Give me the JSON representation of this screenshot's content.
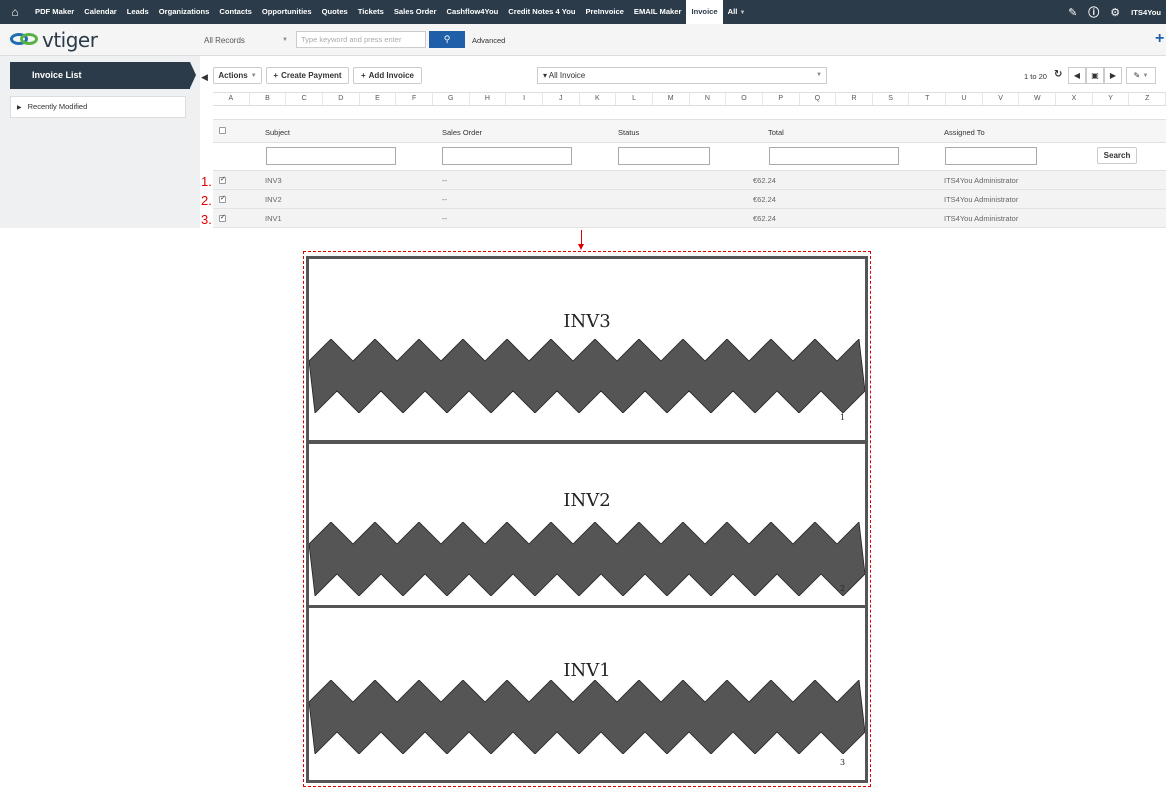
{
  "topnav": {
    "items": [
      {
        "label": "PDF Maker"
      },
      {
        "label": "Calendar"
      },
      {
        "label": "Leads"
      },
      {
        "label": "Organizations"
      },
      {
        "label": "Contacts"
      },
      {
        "label": "Opportunities"
      },
      {
        "label": "Quotes"
      },
      {
        "label": "Tickets"
      },
      {
        "label": "Sales Order"
      },
      {
        "label": "Cashflow4You"
      },
      {
        "label": "Credit Notes 4 You"
      },
      {
        "label": "PreInvoice"
      },
      {
        "label": "EMAIL Maker"
      },
      {
        "label": "Invoice",
        "active": true
      },
      {
        "label": "All"
      }
    ],
    "user": "ITS4You"
  },
  "header": {
    "logo_text": "vtiger",
    "records_select": "All Records",
    "search_placeholder": "Type keyword and press enter",
    "advanced_label": "Advanced"
  },
  "sidebar": {
    "title": "Invoice List",
    "recently_modified": "Recently Modified"
  },
  "toolbar": {
    "actions_label": "Actions",
    "create_payment_label": "Create Payment",
    "add_invoice_label": "Add Invoice",
    "filter_label": "All Invoice",
    "page_info": "1 to 20"
  },
  "alphabet": [
    "A",
    "B",
    "C",
    "D",
    "E",
    "F",
    "G",
    "H",
    "I",
    "J",
    "K",
    "L",
    "M",
    "N",
    "O",
    "P",
    "Q",
    "R",
    "S",
    "T",
    "U",
    "V",
    "W",
    "X",
    "Y",
    "Z"
  ],
  "table": {
    "columns": [
      "Subject",
      "Sales Order",
      "Status",
      "Total",
      "Assigned To"
    ],
    "search_label": "Search",
    "rows": [
      {
        "num": "1.",
        "subject": "INV3",
        "sales_order": "--",
        "status": "",
        "total": "€62.24",
        "assigned_to": "ITS4You Administrator"
      },
      {
        "num": "2.",
        "subject": "INV2",
        "sales_order": "--",
        "status": "",
        "total": "€62.24",
        "assigned_to": "ITS4You Administrator"
      },
      {
        "num": "3.",
        "subject": "INV1",
        "sales_order": "--",
        "status": "",
        "total": "€62.24",
        "assigned_to": "ITS4You Administrator"
      }
    ]
  },
  "preview": {
    "pages": [
      {
        "title": "INV3",
        "number": "1"
      },
      {
        "title": "INV2",
        "number": "2"
      },
      {
        "title": "INV1",
        "number": "3"
      }
    ]
  },
  "colors": {
    "nav_bg": "#2c3b49",
    "accent_blue": "#1f5ea8",
    "annotation_red": "#e00000",
    "zigzag_fill": "#555555"
  }
}
